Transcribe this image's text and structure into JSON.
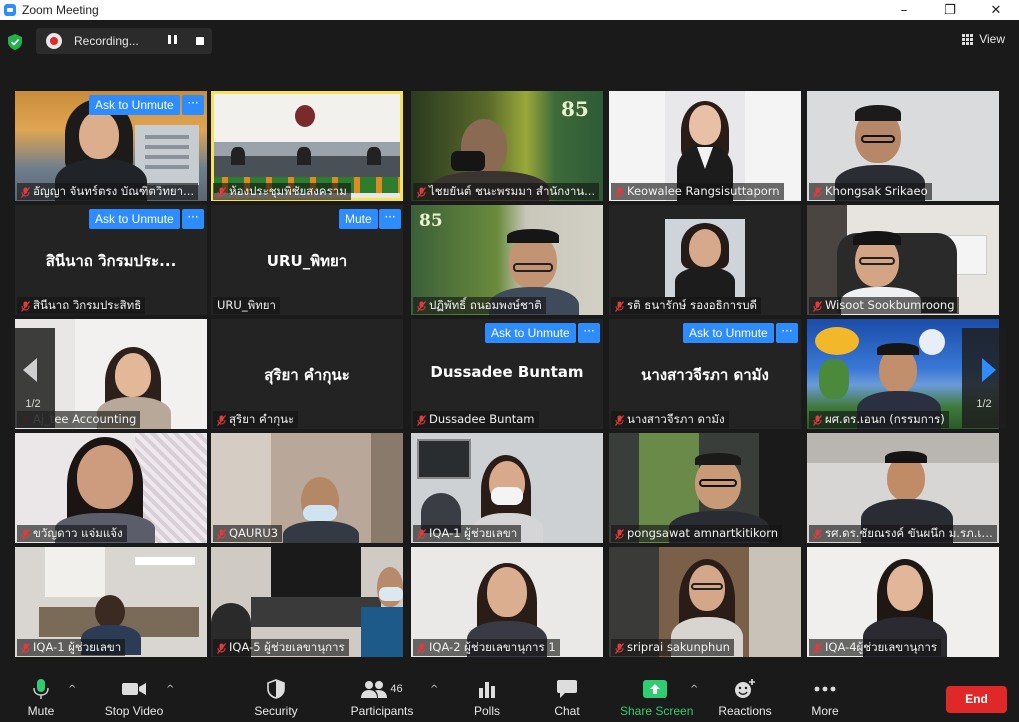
{
  "window": {
    "title": "Zoom Meeting",
    "controls": [
      "–",
      "❐",
      "✕"
    ]
  },
  "recording": {
    "label": "Recording..."
  },
  "view": {
    "label": "View"
  },
  "pager": {
    "left": "1/2",
    "right": "1/2"
  },
  "buttons": {
    "ask_unmute": "Ask to Unmute",
    "mute": "Mute",
    "more": "···"
  },
  "tiles": [
    {
      "name": "อัญญา จันทร์ตรง บัณฑิตวิทยา...",
      "big": ""
    },
    {
      "name": "ห้องประชุมพิชัยสงคราม",
      "big": ""
    },
    {
      "name": "ไชยยันต์ ชนะพรมมา สำนักงาน...",
      "big": ""
    },
    {
      "name": "Keowalee Rangsisuttaporn",
      "big": ""
    },
    {
      "name": "Khongsak Srikaeo",
      "big": ""
    },
    {
      "name": "สินีนาถ วิกรมประสิทธิ",
      "big": "สินีนาถ วิกรมประ..."
    },
    {
      "name": "URU_พิทยา",
      "big": "URU_พิทยา"
    },
    {
      "name": "ปฏิพัทธิ์ ถนอมพงษ์ชาติ",
      "big": ""
    },
    {
      "name": "รติ ธนารักษ์ รองอธิการบดี",
      "big": ""
    },
    {
      "name": "Wisoot Sookbumroong",
      "big": ""
    },
    {
      "name": "Aj_tee Accounting",
      "big": ""
    },
    {
      "name": "สุริยา คำกุนะ",
      "big": "สุริยา คำกุนะ"
    },
    {
      "name": "Dussadee Buntam",
      "big": "Dussadee Buntam"
    },
    {
      "name": "นางสาวจีรภา ดามัง",
      "big": "นางสาวจีรภา ดามัง"
    },
    {
      "name": "ผศ.ดร.เอนก (กรรมการ)",
      "big": ""
    },
    {
      "name": "ขวัญดาว แจ่มแจ้ง",
      "big": ""
    },
    {
      "name": "QAURU3",
      "big": ""
    },
    {
      "name": "IQA-1 ผู้ช่วยเลขา",
      "big": ""
    },
    {
      "name": "pongsawat amnartkitikorn",
      "big": ""
    },
    {
      "name": "รศ.ดร.ชัยณรงค์ ขันผนึก ม.รภ.เพช...",
      "big": ""
    },
    {
      "name": "IQA-1 ผู้ช่วยเลขา",
      "big": ""
    },
    {
      "name": "IQA-5 ผู้ช่วยเลขานุการ",
      "big": ""
    },
    {
      "name": "IQA-2 ผู้ช่วยเลขานุการ 1",
      "big": ""
    },
    {
      "name": "sriprai sakunphun",
      "big": ""
    },
    {
      "name": "IQA-4ผู้ช่วยเลขานุการ",
      "big": ""
    }
  ],
  "toolbar": {
    "mute": "Mute",
    "stop_video": "Stop Video",
    "security": "Security",
    "participants": "Participants",
    "participant_count": "46",
    "polls": "Polls",
    "chat": "Chat",
    "share_screen": "Share Screen",
    "reactions": "Reactions",
    "more": "More",
    "end": "End"
  },
  "colors": {
    "accent": "#2d8cff",
    "end": "#e02828",
    "share": "#2fcc71",
    "highlight": "#f5e35a"
  }
}
